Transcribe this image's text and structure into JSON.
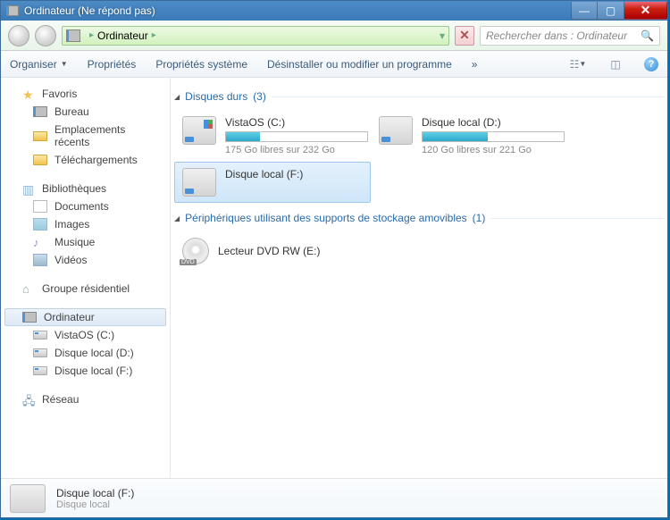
{
  "window": {
    "title": "Ordinateur (Ne répond pas)"
  },
  "breadcrumb": {
    "root": "Ordinateur"
  },
  "search": {
    "placeholder": "Rechercher dans : Ordinateur"
  },
  "toolbar": {
    "organize": "Organiser",
    "properties": "Propriétés",
    "sysprops": "Propriétés système",
    "uninstall": "Désinstaller ou modifier un programme",
    "more": "»"
  },
  "sidebar": {
    "favorites": {
      "label": "Favoris",
      "items": [
        "Bureau",
        "Emplacements récents",
        "Téléchargements"
      ]
    },
    "libraries": {
      "label": "Bibliothèques",
      "items": [
        "Documents",
        "Images",
        "Musique",
        "Vidéos"
      ]
    },
    "homegroup": {
      "label": "Groupe résidentiel"
    },
    "computer": {
      "label": "Ordinateur",
      "items": [
        "VistaOS (C:)",
        "Disque local (D:)",
        "Disque local (F:)"
      ]
    },
    "network": {
      "label": "Réseau"
    }
  },
  "groups": {
    "hdd": {
      "title": "Disques durs",
      "count": "(3)"
    },
    "removable": {
      "title": "Périphériques utilisant des supports de stockage amovibles",
      "count": "(1)"
    }
  },
  "drives": {
    "c": {
      "name": "VistaOS (C:)",
      "sub": "175 Go libres sur 232 Go",
      "fill": 24
    },
    "d": {
      "name": "Disque local (D:)",
      "sub": "120 Go libres sur 221 Go",
      "fill": 46
    },
    "f": {
      "name": "Disque local (F:)"
    },
    "dvd": {
      "name": "Lecteur DVD RW (E:)"
    }
  },
  "status": {
    "name": "Disque local (F:)",
    "type": "Disque local"
  }
}
